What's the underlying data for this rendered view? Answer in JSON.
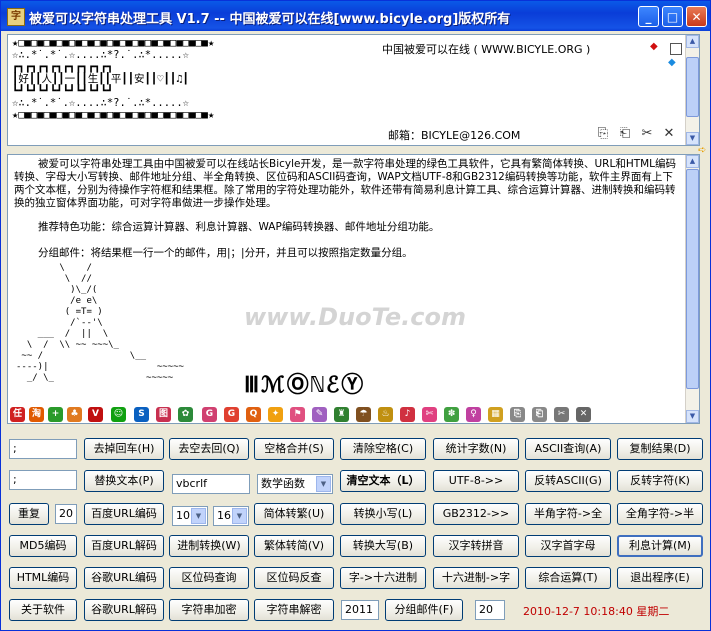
{
  "title": "被爱可以字符串处理工具 V1.7 -- 中国被爱可以在线[www.bicyle.org]版权所有",
  "title_buttons": {
    "min": "_",
    "max": "□",
    "close": "✕"
  },
  "top_pane": {
    "art_lines": [
      "★□■□■□■□■□■□■□■□■□■□■□■□■□■□■□■★",
      "☆∴.*˙.*˙.☆....∴*?.˙.∴*.....☆",
      "┏┓┏┓┏┓┏┓┏┓┏┓┏┓┏┓",
      "┃好┃┃人┃┃一┃┃生┃┃平┃┃安┃┃♡┃┃♫┃",
      "┗┛┗┛┗┛┗┛┗┛┗┛┗┛┗┛",
      "☆∴.*˙.*˙.☆....∴*?.˙.∴*.....☆",
      "★□■□■□■□■□■□■□■□■□■□■□■□■□■□■□■★"
    ],
    "site_text": "中国被爱可以在线 ( WWW.BICYLE.ORG )",
    "email_text": "邮箱：BICYLE@126.COM",
    "icons": [
      "gem-icon",
      "checkbox",
      "diamond-icon",
      "copy-icon",
      "paste-icon",
      "cut-icon",
      "clear-icon"
    ]
  },
  "main_pane": {
    "para1": "被爱可以字符串处理工具由中国被爱可以在线站长Bicyle开发，是一款字符串处理的绿色工具软件，它具有繁简体转换、URL和HTML编码转换、字母大小写转换、邮件地址分组、半全角转换、区位码和ASCII码查询，WAP文档UTF-8和GB2312编码转换等功能，软件主界面有上下两个文本框，分别为待操作字符框和结果框。除了常用的字符处理功能外，软件还带有简易利息计算工具、综合运算计算器、进制转换和编码转换的独立窗体界面功能，可对字符串做进一步操作处理。",
    "para2": "推荐特色功能：综合运算计算器、利息计算器、WAP编码转换器、邮件地址分组功能。",
    "para3": "分组邮件：将结果框一行一个的邮件，用|；|分开，并且可以按照指定数量分组。",
    "ascii_art": "        \\    /\n         \\  //\n          )\\_/(\n          /e e\\\n         ( =T= )\n          /`--'\\\n    ___  /  ||  \\\n  \\  /  \\\\ ~~ ~~~\\_\n ~~ /                \\__\n----)|                    ~~~~~\n  _/ \\_                 ~~~~~",
    "big_word": "ⅢℳⓄℕℰⓎ",
    "watermark": "www.DuoTe.com"
  },
  "iconbar": [
    "任",
    "淘",
    "+",
    "♣",
    "V",
    "☺",
    "S",
    "图",
    "✿",
    "G",
    "G",
    "Q",
    "✦",
    "⚑",
    "✎",
    "♜",
    "☂",
    "♨",
    "♪",
    "✄",
    "✽",
    "♀",
    "▦",
    "⎘",
    "⎗",
    "✂",
    "✕"
  ],
  "buttons": {
    "r1": [
      "去掉回车(H)",
      "去空去回(Q)",
      "空格合并(S)",
      "清除空格(C)",
      "统计字数(N)",
      "ASCII查询(A)",
      "复制结果(D)"
    ],
    "r2": [
      "替换文本(P)",
      "清空文本（L）",
      "UTF-8->>",
      "反转ASCII(G)",
      "反转字符(K)"
    ],
    "r3": [
      "重复",
      "百度URL编码",
      "简体转繁(U)",
      "转换小写(L)",
      "GB2312->>",
      "半角字符->全",
      "全角字符->半"
    ],
    "r4": [
      "MD5编码",
      "百度URL解码",
      "进制转换(W)",
      "繁体转简(V)",
      "转换大写(B)",
      "汉字转拼音",
      "汉字首字母",
      "利息计算(M)"
    ],
    "r5": [
      "HTML编码",
      "谷歌URL编码",
      "区位码查询",
      "区位码反查",
      "字->十六进制",
      "十六进制->字",
      "综合运算(T)",
      "退出程序(E)"
    ],
    "r6": [
      "关于软件",
      "谷歌URL解码",
      "字符串加密",
      "字符串解密",
      "分组邮件(F)"
    ]
  },
  "inputs": {
    "in1": ";",
    "in2": ";",
    "in3": "vbcrlf",
    "repeat": "20",
    "year": "2011",
    "group_count": "20"
  },
  "selects": {
    "func": "数学函数",
    "num_a": "10",
    "num_b": "16"
  },
  "clock": "2010-12-7 10:18:40 星期二"
}
